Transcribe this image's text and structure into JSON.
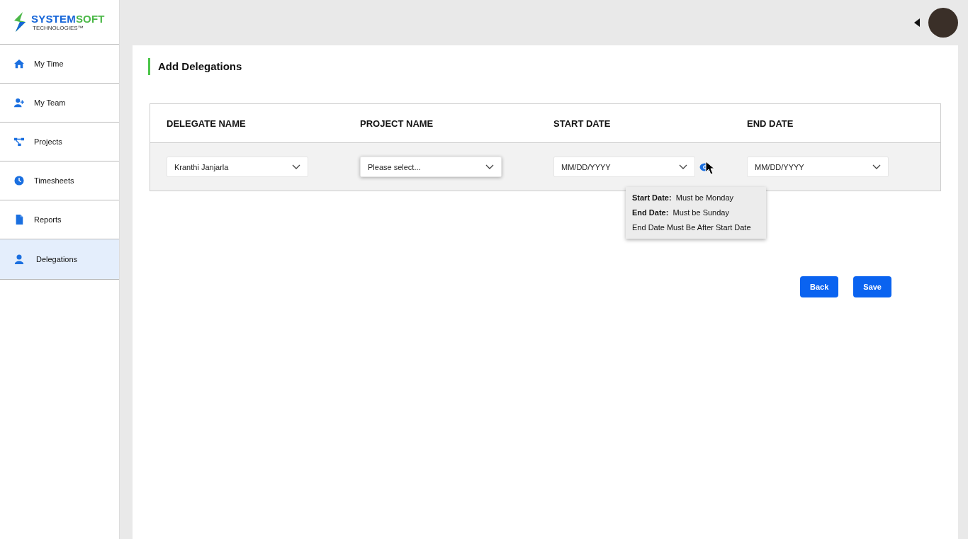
{
  "logo": {
    "primary": "SYSTEM",
    "secondary": "SOFT",
    "tagline": "TECHNOLOGIES™"
  },
  "sidebar": {
    "items": [
      {
        "label": "My Time",
        "kind": "home",
        "selected": false
      },
      {
        "label": "My Team",
        "kind": "team",
        "selected": false
      },
      {
        "label": "Projects",
        "kind": "projects",
        "selected": false
      },
      {
        "label": "Timesheets",
        "kind": "timesheets",
        "selected": false
      },
      {
        "label": "Reports",
        "kind": "reports",
        "selected": false
      },
      {
        "label": "Delegations",
        "kind": "delegations",
        "selected": true
      }
    ]
  },
  "page": {
    "title": "Add Delegations"
  },
  "table": {
    "columns": [
      "DELEGATE NAME",
      "PROJECT NAME",
      "START DATE",
      "END DATE"
    ],
    "fields": [
      {
        "value": "Kranthi Janjarla",
        "focused": false
      },
      {
        "placeholder": "Please select...",
        "focused": true
      },
      {
        "placeholder": "MM/DD/YYYY",
        "focused": false,
        "info": true
      },
      {
        "placeholder": "MM/DD/YYYY",
        "focused": false
      }
    ]
  },
  "tooltip": {
    "lines": [
      {
        "label": "Start Date:",
        "text": "Must be Monday"
      },
      {
        "label": "End Date:",
        "text": "Must be Sunday"
      },
      {
        "text": "End Date Must Be After Start Date"
      }
    ]
  },
  "buttons": [
    "Back",
    "Save"
  ]
}
